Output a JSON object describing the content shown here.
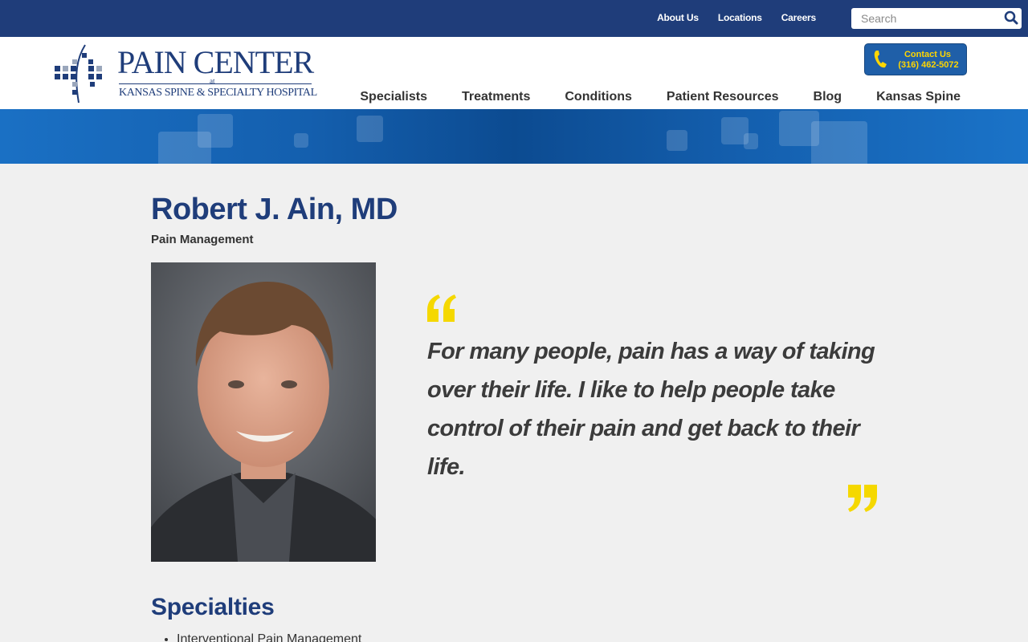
{
  "topbar": {
    "links": [
      "About Us",
      "Locations",
      "Careers"
    ],
    "search_placeholder": "Search"
  },
  "logo": {
    "name": "PAIN CENTER",
    "at": "at",
    "sub": "KANSAS SPINE & SPECIALTY HOSPITAL"
  },
  "contact": {
    "label": "Contact Us",
    "phone": "(316) 462-5072"
  },
  "nav": [
    "Specialists",
    "Treatments",
    "Conditions",
    "Patient Resources",
    "Blog",
    "Kansas Spine"
  ],
  "doctor": {
    "name": "Robert J. Ain, MD",
    "specialty": "Pain Management",
    "quote": "For many people, pain has a way of taking over their life. I like to help people take control of their pain and get back to their life."
  },
  "specialties": {
    "heading": "Specialties",
    "items": [
      "Interventional Pain Management"
    ]
  },
  "colors": {
    "navy": "#1f3d7a",
    "banner_blue": "#145fae",
    "quote_yellow": "#f5d800",
    "contact_text": "#ffd600"
  },
  "icons": [
    "search-icon",
    "phone-icon",
    "open-quote-icon",
    "close-quote-icon"
  ]
}
